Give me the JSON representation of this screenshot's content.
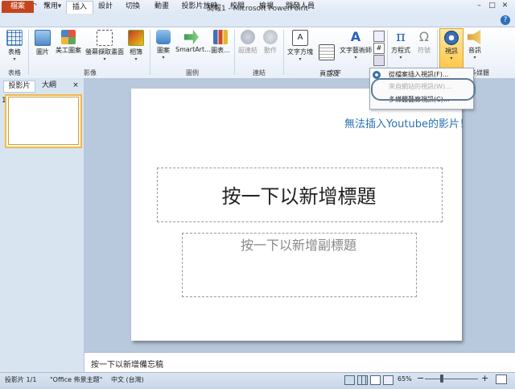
{
  "window": {
    "title": "簡報1 - Microsoft PowerPoint",
    "app_icon": "P",
    "qat": [
      "save-icon",
      "undo-icon",
      "redo-icon",
      "customize-icon"
    ],
    "buttons": [
      "minimize-icon",
      "maximize-icon",
      "close-icon"
    ]
  },
  "tabs": [
    "檔案",
    "常用",
    "插入",
    "設計",
    "切換",
    "動畫",
    "投影片放映",
    "校閱",
    "檢視",
    "開發人員"
  ],
  "ribbon": {
    "buttons": [
      {
        "label": "表格"
      },
      {
        "label": "圖片"
      },
      {
        "label": "美工圖案"
      },
      {
        "label": "螢幕擷取畫面"
      },
      {
        "label": "相簿"
      },
      {
        "label": "圖案"
      },
      {
        "label": "SmartArt..."
      },
      {
        "label": "圖表..."
      },
      {
        "label": "超連結"
      },
      {
        "label": "動作"
      },
      {
        "label": "文字方塊"
      },
      {
        "label": "頁首及\n頁尾"
      },
      {
        "label": "文字藝術師"
      },
      {
        "label": "方程式"
      },
      {
        "label": "符號"
      },
      {
        "label": "視訊"
      },
      {
        "label": "音訊"
      }
    ],
    "groups": [
      "表格",
      "影像",
      "圖例",
      "連結",
      "文字",
      "符號",
      "多媒體"
    ]
  },
  "video_menu": {
    "items": [
      {
        "label": "從檔案插入視訊(F)..."
      },
      {
        "label": "來自網站的視訊(W)..."
      },
      {
        "label": "多媒體藝廊視訊(C)..."
      }
    ]
  },
  "left_panel": {
    "tabs": [
      "投影片",
      "大綱"
    ],
    "close": "×",
    "slide_number": "1"
  },
  "slide": {
    "title_placeholder": "按一下以新增標題",
    "subtitle_placeholder": "按一下以新增副標題"
  },
  "annotation": "無法插入Youtube的影片！",
  "notes_placeholder": "按一下以新增備忘稿",
  "status": {
    "slide_info": "投影片 1/1",
    "theme": "\"Office 佈景主題\"",
    "language": "中文 (台灣)",
    "zoom": "65%"
  },
  "colors": {
    "file_tab": "#c5441f",
    "annotation": "#2a6fb4",
    "highlight_ring": "#5b7c99"
  }
}
